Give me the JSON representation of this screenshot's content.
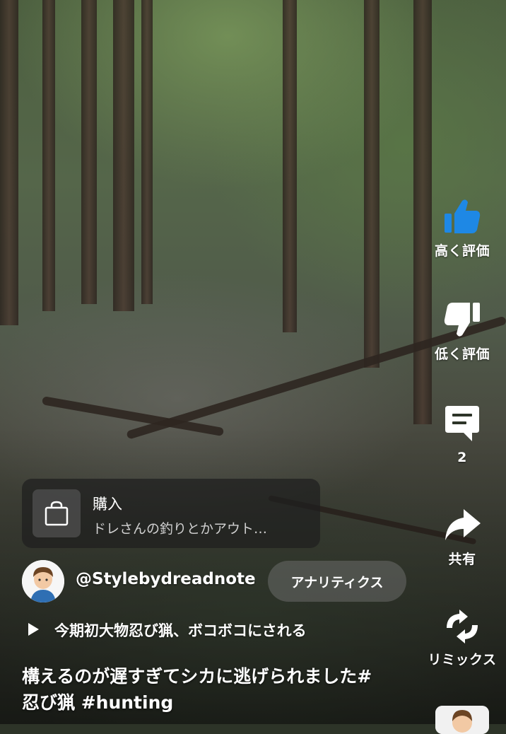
{
  "actions": {
    "like_label": "高く評価",
    "dislike_label": "低く評価",
    "comment_count": "2",
    "share_label": "共有",
    "remix_label": "リミックス"
  },
  "shopping": {
    "title": "購入",
    "product_name": "ドレさんの釣りとかアウト…"
  },
  "channel": {
    "handle": "@Stylebydreadnote",
    "analytics_label": "アナリティクス"
  },
  "related_video": {
    "title": "今期初大物忍び猟、ボコボコにされる"
  },
  "caption": {
    "line1": "構えるのが遅すぎてシカに逃げられました#",
    "line2": "忍び猟 #hunting"
  },
  "icons": {
    "like": "thumbs-up-icon",
    "dislike": "thumbs-down-icon",
    "comment": "comment-icon",
    "share": "share-icon",
    "remix": "remix-icon",
    "shopping": "shopping-bag-icon",
    "play": "play-icon"
  },
  "colors": {
    "like_active": "#1e88e5",
    "text": "#ffffff"
  }
}
